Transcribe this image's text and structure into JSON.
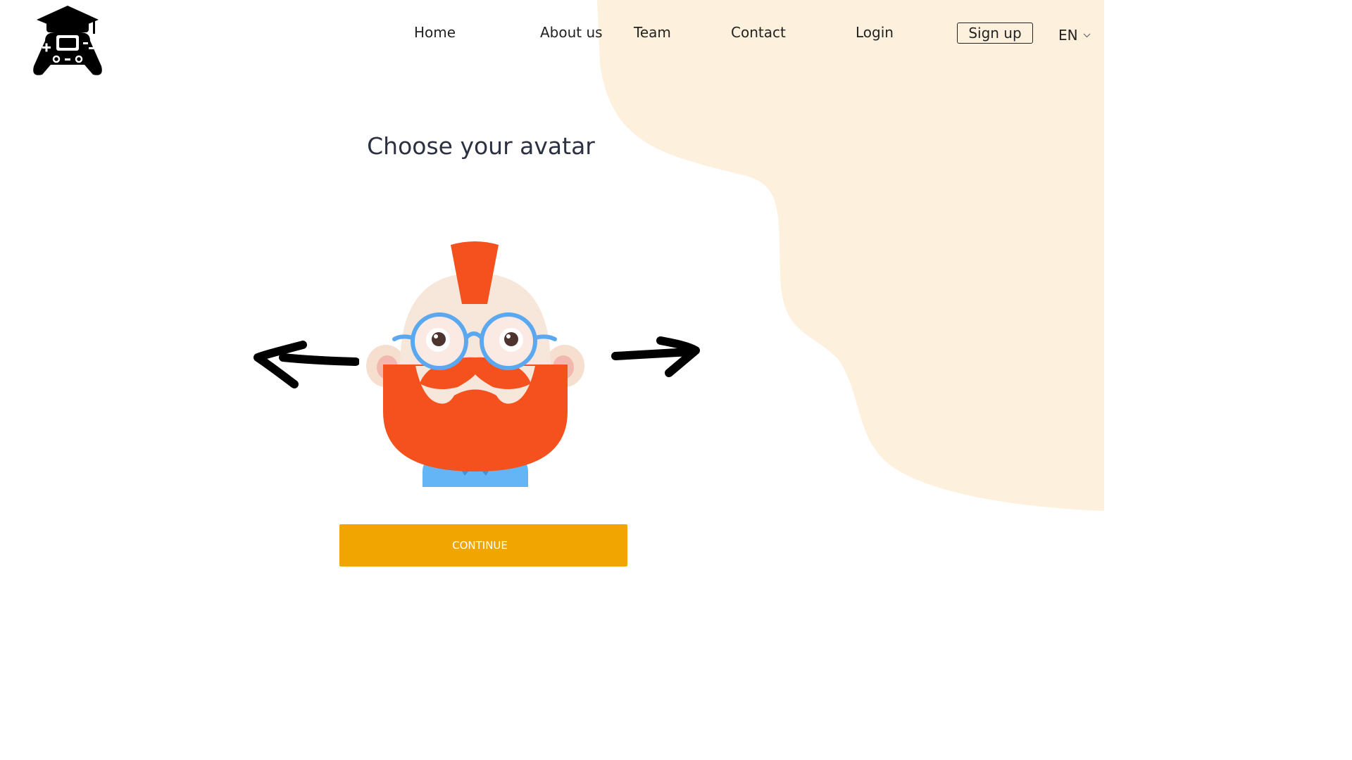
{
  "nav": {
    "home": "Home",
    "about": "About us",
    "team": "Team",
    "contact": "Contact",
    "login": "Login",
    "signup": "Sign up",
    "language": "EN"
  },
  "main": {
    "title": "Choose your avatar",
    "continue_label": "CONTINUE"
  },
  "icons": {
    "logo": "gamepad-graduation-cap-icon",
    "prev": "left-arrow-icon",
    "next": "right-arrow-icon",
    "language_dropdown": "chevron-down-icon"
  },
  "colors": {
    "background_blob": "#fdf0dc",
    "continue_button": "#f0a500",
    "title_text": "#2b3140",
    "avatar_beard": "#f4511e",
    "avatar_glasses": "#5aa9f0"
  }
}
